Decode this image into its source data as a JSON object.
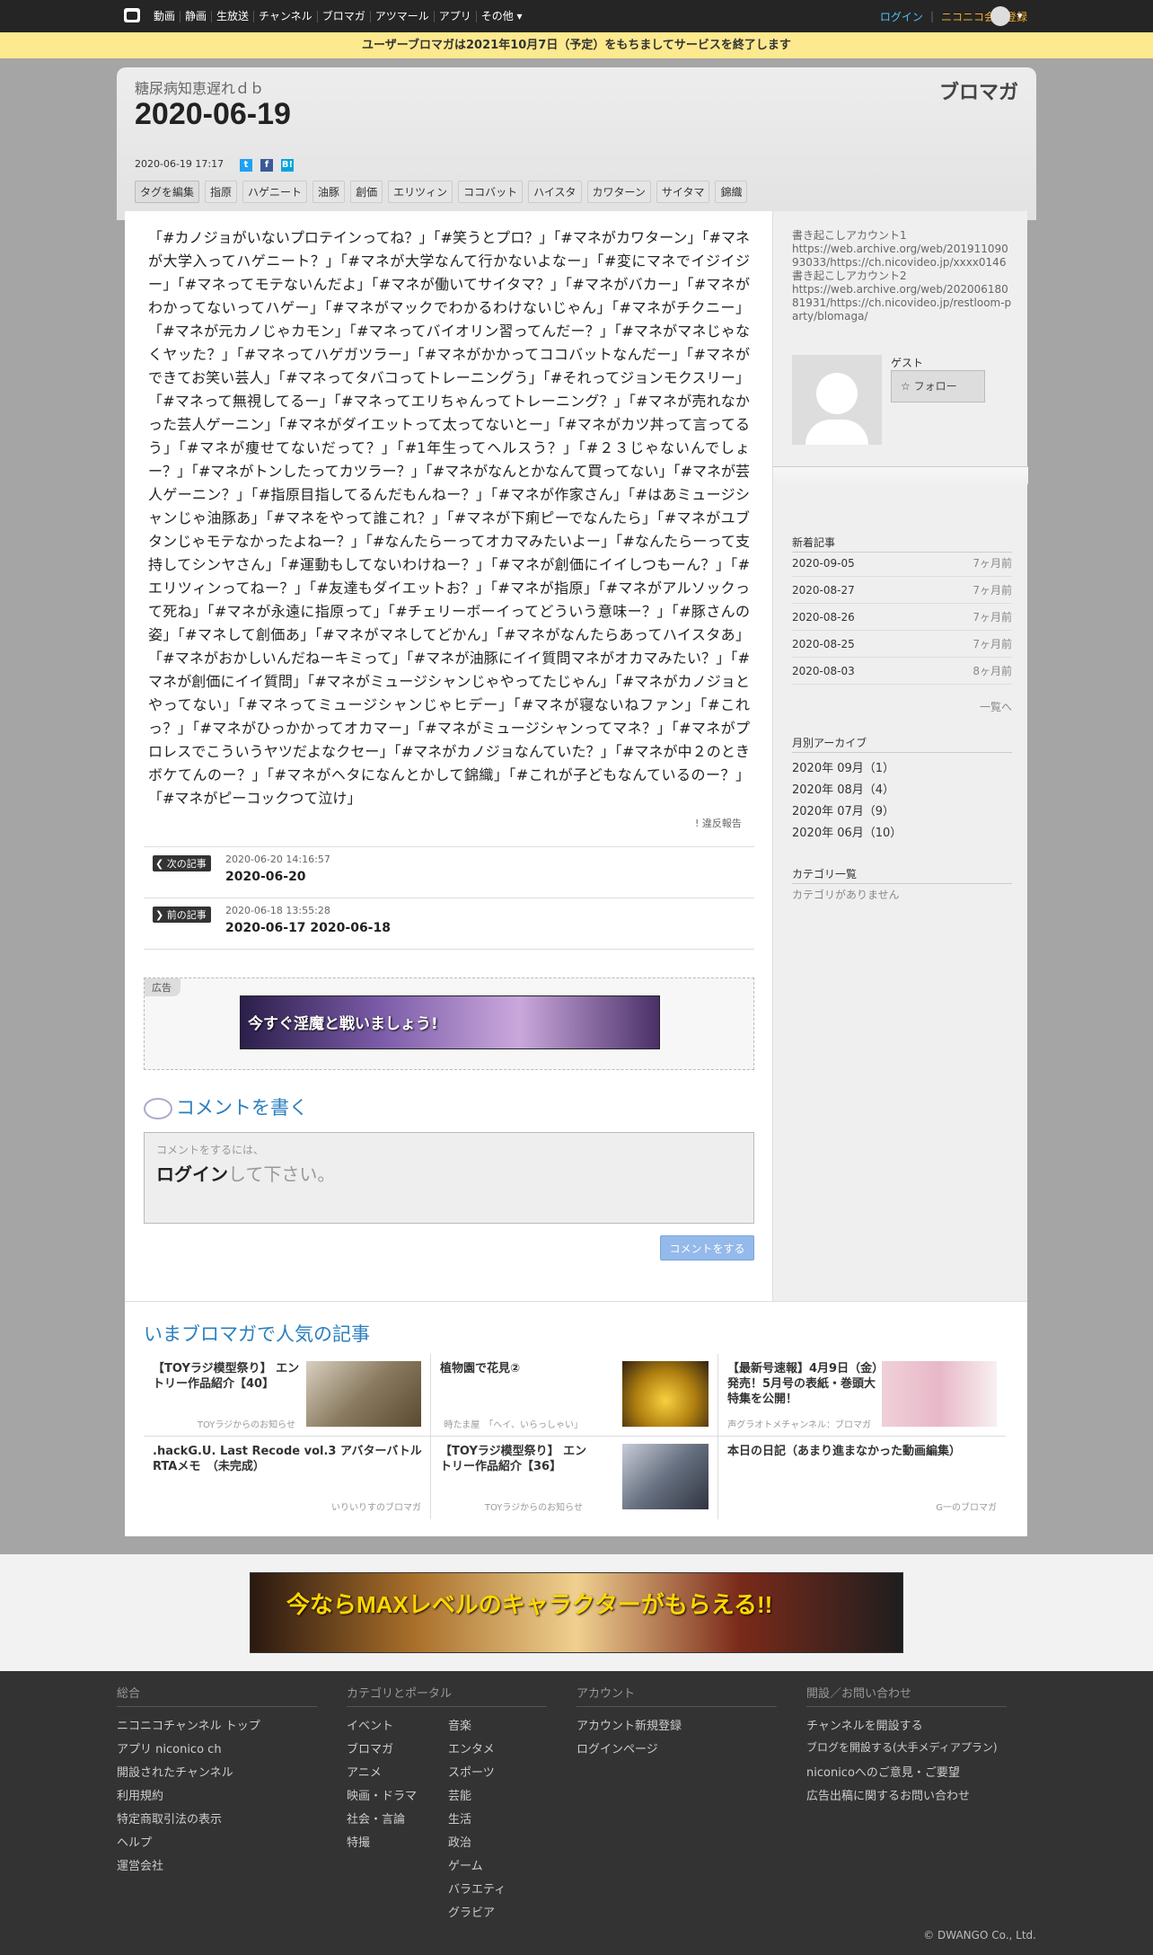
{
  "topbar": {
    "nav": [
      "動画",
      "静画",
      "生放送",
      "チャンネル",
      "ブロマガ",
      "アツマール",
      "アプリ",
      "その他 ▾"
    ],
    "login": "ログイン",
    "register": "ニコニコ会員登録",
    "user_chevron": "▾"
  },
  "notice": "ユーザーブロマガは2021年10月7日（予定）をもちましてサービスを終了します",
  "header": {
    "blog_name": "糖尿病知恵遅れｄｂ",
    "title": "2020-06-19",
    "logo": "ブロマガ",
    "date": "2020-06-19 17:17",
    "tags": [
      "タグを編集",
      "指原",
      "ハゲニート",
      "油豚",
      "創価",
      "エリツィン",
      "ココバット",
      "ハイスタ",
      "カワターン",
      "サイタマ",
      "錦織"
    ]
  },
  "article": {
    "body": "「#カノジョがいないプロテインってね？」「#笑うとプロ？」「#マネがカワターン」「#マネが大学入ってハゲニート？」「#マネが大学なんて行かないよなー」「#変にマネでイジイジー」「#マネってモテないんだよ」「#マネが働いてサイタマ？」「#マネがバカー」「#マネがわかってないってハゲー」「#マネがマックでわかるわけないじゃん」「#マネがチクニー」「#マネが元カノじゃカモン」「#マネってバイオリン習ってんだー？」「#マネがマネじゃなくヤッた？」「#マネってハゲガツラー」「#マネがかかってココバットなんだー」「#マネができてお笑い芸人」「#マネってタバコってトレーニングう」「#それってジョンモクスリー」「#マネって無視してるー」「#マネってエリちゃんってトレーニング？」「#マネが売れなかった芸人ゲーニン」「#マネがダイエットって太ってないとー」「#マネがカツ丼って言ってるう」「#マネが痩せてないだって？」「#1年生ってヘルスう？」「#２３じゃないんでしょー？」「#マネがトンしたってカツラー？」「#マネがなんとかなんて買ってない」「#マネが芸人ゲーニン？」「#指原目指してるんだもんねー？」「#マネが作家さん」「#はあミュージシャンじゃ油豚あ」「#マネをやって誰これ？」「#マネが下痢ピーでなんたら」「#マネがユブタンじゃモテなかったよねー？」「#なんたらーってオカマみたいよー」「#なんたらーって支持してシンヤさん」「#運動もしてないわけねー？」「#マネが創価にイイしつもーん？」「#エリツィンってねー？」「#友達もダイエットお？」「#マネが指原」「#マネがアルソックって死ね」「#マネが永遠に指原って」「#チェリーボーイってどういう意味ー？」「#豚さんの姿」「#マネして創価あ」「#マネがマネしてどかん」「#マネがなんたらあってハイスタあ」「#マネがおかしいんだねーキミって」「#マネが油豚にイイ質問マネがオカマみたい？」「#マネが創価にイイ質問」「#マネがミュージシャンじゃやってたじゃん」「#マネがカノジョとやってない」「#マネってミュージシャンじゃヒデー」「#マネが寝ないねファン」「#これっ？」「#マネがひっかかってオカマー」「#マネがミュージシャンってマネ？」「#マネがプロレスでこういうヤツだよなクセー」「#マネがカノジョなんていた？」「#マネが中２のときボケてんのー？」「#マネがヘタになんとかして錦織」「#これが子どもなんているのー？」「#マネがピーコックつて泣け」",
    "report": "! 違反報告",
    "next": {
      "label": "次の記事",
      "date": "2020-06-20 14:16:57",
      "title": "2020-06-20"
    },
    "prev": {
      "label": "前の記事",
      "date": "2020-06-18 13:55:28",
      "title": "2020-06-17 2020-06-18"
    },
    "ad_label": "広告",
    "ad_banner_text": "今すぐ淫魔と戦いましょう!",
    "comment_title": "コメントを書く",
    "comment_hint": "コメントをするには、",
    "comment_login": "ログイン",
    "comment_suffix": "して下さい。",
    "comment_button": "コメントをする"
  },
  "sidebar": {
    "description": "書き起こしアカウント1\nhttps://web.archive.org/web/20191109093033/https://ch.nicovideo.jp/xxxx0146\n書き起こしアカウント2\nhttps://web.archive.org/web/20200618081931/https://ch.nicovideo.jp/restloom-party/blomaga/",
    "guest": "ゲスト",
    "follow": "フォロー",
    "news_heading": "新着記事",
    "news": [
      {
        "date": "2020-09-05",
        "ago": "7ヶ月前"
      },
      {
        "date": "2020-08-27",
        "ago": "7ヶ月前"
      },
      {
        "date": "2020-08-26",
        "ago": "7ヶ月前"
      },
      {
        "date": "2020-08-25",
        "ago": "7ヶ月前"
      },
      {
        "date": "2020-08-03",
        "ago": "8ヶ月前"
      }
    ],
    "more": "一覧へ",
    "archive_heading": "月別アーカイブ",
    "archive": [
      "2020年 09月（1）",
      "2020年 08月（4）",
      "2020年 07月（9）",
      "2020年 06月（10）"
    ],
    "category_heading": "カテゴリ一覧",
    "category_empty": "カテゴリがありません"
  },
  "popular": {
    "title": "いまブロマガで人気の記事",
    "items": [
      {
        "title": "【TOYラジ模型祭り】 エントリー作品紹介【40】",
        "source": "TOYラジからのお知らせ",
        "color": "#8a7a60"
      },
      {
        "title": "植物園で花見②",
        "source": "時たま屋　「へイ、いらっしゃい」",
        "color": "#e0b020"
      },
      {
        "title": "【最新号速報】4月9日（金）発売！5月号の表紙・巻頭大特集を公開！",
        "source": "声グラオトメチャンネル：ブロマガ",
        "color": "#e8b8c8"
      },
      {
        "title": ".hackG.U. Last Recode vol.3 アバターバトルRTAメモ　（未完成）",
        "source": "いりいりすのブロマガ",
        "color": ""
      },
      {
        "title": "【TOYラジ模型祭り】 エントリー作品紹介【36】",
        "source": "TOYラジからのお知らせ",
        "color": "#667080"
      },
      {
        "title": "本日の日記（あまり進まなかった動画編集）",
        "source": "G一のブロマガ",
        "color": ""
      }
    ]
  },
  "ad2_text": "今ならMAXレベルのキャラクターがもらえる!!",
  "footer": {
    "col1_heading": "総合",
    "col1": [
      "ニコニコチャンネル トップ",
      "アプリ niconico ch",
      "開設されたチャンネル",
      "利用規約",
      "特定商取引法の表示",
      "ヘルプ",
      "運営会社"
    ],
    "col2_heading": "カテゴリとポータル",
    "col2a": [
      "イベント",
      "ブロマガ",
      "アニメ",
      "映画・ドラマ",
      "社会・言論",
      "特撮"
    ],
    "col2b": [
      "音楽",
      "エンタメ",
      "スポーツ",
      "芸能",
      "生活",
      "政治",
      "ゲーム",
      "バラエティ",
      "グラビア"
    ],
    "col3_heading": "アカウント",
    "col3": [
      "アカウント新規登録",
      "ログインページ"
    ],
    "col4_heading": "開設／お問い合わせ",
    "col4": [
      "チャンネルを開設する",
      "ブログを開設する(大手メディアプラン)",
      "niconicoへのご意見・ご要望",
      "広告出稿に関するお問い合わせ"
    ],
    "copyright": "© DWANGO Co., Ltd."
  }
}
